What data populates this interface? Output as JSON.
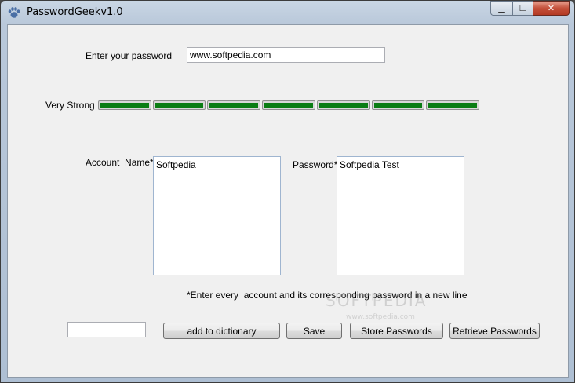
{
  "window": {
    "title": "PasswordGeekv1.0",
    "controls": {
      "minimize": "▁",
      "maximize": "☐",
      "close": "✕"
    }
  },
  "password_entry": {
    "label": "Enter your password",
    "value": "www.softpedia.com"
  },
  "strength": {
    "label": "Very Strong",
    "segments_total": 7,
    "segments_filled": 7,
    "fill_color": "#0a7d14"
  },
  "accounts": {
    "account_label": "Account  Name*",
    "account_value": "Softpedia",
    "password_label": "Password*",
    "password_value": "Softpedia Test",
    "note": "*Enter every  account and its corresponding password in a new line"
  },
  "toolbar": {
    "dictionary_input_value": "",
    "add_to_dictionary": "add to dictionary",
    "save": "Save",
    "store_passwords": "Store Passwords",
    "retrieve_passwords": "Retrieve Passwords"
  },
  "watermark": {
    "text": "SOFTPEDIA",
    "sub": "www.softpedia.com"
  }
}
